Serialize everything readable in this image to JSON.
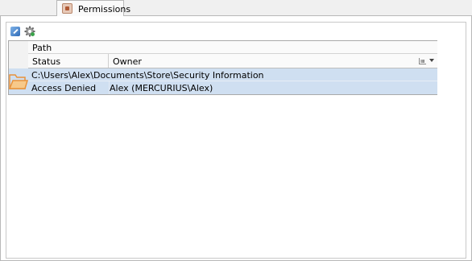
{
  "tab": {
    "label": "Permissions",
    "icon": "lock-document-icon"
  },
  "toolbar": {
    "buttons": [
      {
        "icon": "wrench-icon"
      },
      {
        "icon": "gear-icon"
      }
    ]
  },
  "grid": {
    "headers": {
      "path": "Path",
      "status": "Status",
      "owner": "Owner"
    },
    "rows": [
      {
        "icon": "folder-icon",
        "path": "C:\\Users\\Alex\\Documents\\Store\\Security Information",
        "status": "Access Denied",
        "owner": "Alex (MERCURIUS\\Alex)"
      }
    ]
  },
  "colors": {
    "selection": "#cfdff1",
    "folder": "#f0a742",
    "panel_border": "#b8b8b8"
  }
}
